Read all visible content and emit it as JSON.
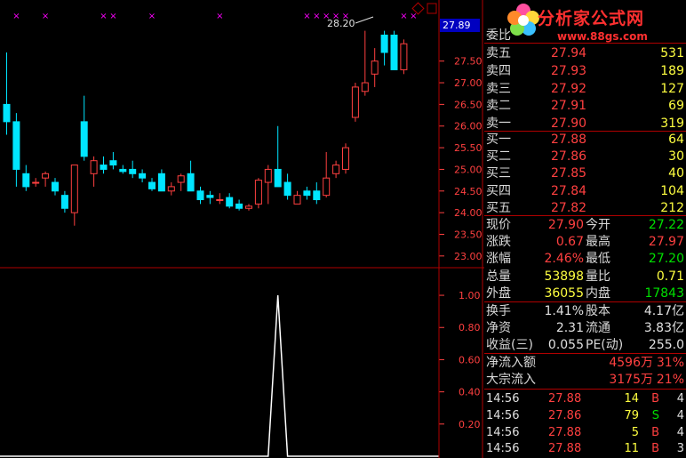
{
  "logo": {
    "title": "分析家公式网",
    "url": "www.88gs.com"
  },
  "price_tag": "27.89",
  "peak_annotation": "28.20",
  "order_book": {
    "header_label": "委比",
    "asks": [
      {
        "label": "卖五",
        "price": "27.94",
        "vol": "531"
      },
      {
        "label": "卖四",
        "price": "27.93",
        "vol": "189"
      },
      {
        "label": "卖三",
        "price": "27.92",
        "vol": "127"
      },
      {
        "label": "卖二",
        "price": "27.91",
        "vol": "69"
      },
      {
        "label": "卖一",
        "price": "27.90",
        "vol": "319"
      }
    ],
    "bids": [
      {
        "label": "买一",
        "price": "27.88",
        "vol": "64"
      },
      {
        "label": "买二",
        "price": "27.86",
        "vol": "30"
      },
      {
        "label": "买三",
        "price": "27.85",
        "vol": "40"
      },
      {
        "label": "买四",
        "price": "27.84",
        "vol": "104"
      },
      {
        "label": "买五",
        "price": "27.82",
        "vol": "212"
      }
    ]
  },
  "quote": [
    {
      "l1": "现价",
      "v1": "27.90",
      "l2": "今开",
      "v2": "27.22"
    },
    {
      "l1": "涨跌",
      "v1": "0.67",
      "l2": "最高",
      "v2": "27.97"
    },
    {
      "l1": "涨幅",
      "v1": "2.46%",
      "l2": "最低",
      "v2": "27.20"
    },
    {
      "l1": "总量",
      "v1": "53898",
      "l2": "量比",
      "v2": "0.71"
    },
    {
      "l1": "外盘",
      "v1": "36055",
      "l2": "内盘",
      "v2": "17843"
    }
  ],
  "fundamentals": [
    {
      "l1": "换手",
      "v1": "1.41%",
      "l2": "股本",
      "v2": "4.17亿"
    },
    {
      "l1": "净资",
      "v1": "2.31",
      "l2": "流通",
      "v2": "3.83亿"
    },
    {
      "l1": "收益(三)",
      "v1": "0.055",
      "l2": "PE(动)",
      "v2": "255.0"
    }
  ],
  "flows": [
    {
      "label": "净流入额",
      "value": "4596万",
      "pct": "31%"
    },
    {
      "label": "大宗流入",
      "value": "3175万",
      "pct": "21%"
    }
  ],
  "ticks": [
    {
      "time": "14:56",
      "price": "27.88",
      "vol": "14",
      "side": "B",
      "n": "4"
    },
    {
      "time": "14:56",
      "price": "27.86",
      "vol": "79",
      "side": "S",
      "n": "4"
    },
    {
      "time": "14:56",
      "price": "27.88",
      "vol": "5",
      "side": "B",
      "n": "4"
    },
    {
      "time": "14:56",
      "price": "27.88",
      "vol": "11",
      "side": "B",
      "n": "3"
    }
  ],
  "colors": {
    "up": "#ff4040",
    "down": "#00e5ff",
    "grid": "#b00000",
    "axis": "#ff4040",
    "indicator": "#ffffff",
    "marker": "#ff00ff"
  },
  "chart_data": [
    {
      "type": "candlestick",
      "y_axis_ticks": [
        "27.50",
        "27.00",
        "26.50",
        "26.00",
        "25.50",
        "25.00",
        "24.50",
        "24.00",
        "23.50",
        "23.00"
      ],
      "ylim": [
        22.75,
        28.5
      ],
      "candles": [
        {
          "o": 26.5,
          "h": 27.7,
          "l": 25.8,
          "c": 26.1
        },
        {
          "o": 26.1,
          "h": 26.3,
          "l": 24.6,
          "c": 25.0
        },
        {
          "o": 24.9,
          "h": 25.1,
          "l": 24.5,
          "c": 24.6
        },
        {
          "o": 24.7,
          "h": 24.8,
          "l": 24.6,
          "c": 24.7
        },
        {
          "o": 24.8,
          "h": 24.95,
          "l": 24.6,
          "c": 24.9
        },
        {
          "o": 24.7,
          "h": 24.8,
          "l": 24.4,
          "c": 24.5
        },
        {
          "o": 24.4,
          "h": 24.5,
          "l": 24.0,
          "c": 24.1
        },
        {
          "o": 24.0,
          "h": 25.1,
          "l": 23.7,
          "c": 25.1
        },
        {
          "o": 26.1,
          "h": 26.7,
          "l": 25.2,
          "c": 25.3
        },
        {
          "o": 24.9,
          "h": 25.3,
          "l": 24.6,
          "c": 25.2
        },
        {
          "o": 25.1,
          "h": 25.3,
          "l": 24.9,
          "c": 25.0
        },
        {
          "o": 25.2,
          "h": 25.4,
          "l": 25.0,
          "c": 25.1
        },
        {
          "o": 25.0,
          "h": 25.1,
          "l": 24.9,
          "c": 24.95
        },
        {
          "o": 25.0,
          "h": 25.2,
          "l": 24.8,
          "c": 24.9
        },
        {
          "o": 24.9,
          "h": 25.0,
          "l": 24.7,
          "c": 24.8
        },
        {
          "o": 24.7,
          "h": 24.8,
          "l": 24.5,
          "c": 24.55
        },
        {
          "o": 24.9,
          "h": 25.0,
          "l": 24.5,
          "c": 24.5
        },
        {
          "o": 24.5,
          "h": 24.7,
          "l": 24.4,
          "c": 24.6
        },
        {
          "o": 24.7,
          "h": 24.9,
          "l": 24.5,
          "c": 24.85
        },
        {
          "o": 24.9,
          "h": 25.2,
          "l": 24.5,
          "c": 24.5
        },
        {
          "o": 24.5,
          "h": 24.6,
          "l": 24.2,
          "c": 24.3
        },
        {
          "o": 24.4,
          "h": 24.5,
          "l": 24.2,
          "c": 24.35
        },
        {
          "o": 24.3,
          "h": 24.45,
          "l": 24.2,
          "c": 24.3
        },
        {
          "o": 24.35,
          "h": 24.45,
          "l": 24.1,
          "c": 24.15
        },
        {
          "o": 24.2,
          "h": 24.3,
          "l": 24.05,
          "c": 24.1
        },
        {
          "o": 24.1,
          "h": 24.2,
          "l": 24.05,
          "c": 24.15
        },
        {
          "o": 24.2,
          "h": 24.8,
          "l": 24.1,
          "c": 24.75
        },
        {
          "o": 24.7,
          "h": 25.1,
          "l": 24.2,
          "c": 25.0
        },
        {
          "o": 25.0,
          "h": 26.0,
          "l": 24.8,
          "c": 24.6
        },
        {
          "o": 24.7,
          "h": 24.9,
          "l": 24.3,
          "c": 24.4
        },
        {
          "o": 24.2,
          "h": 24.5,
          "l": 24.2,
          "c": 24.4
        },
        {
          "o": 24.5,
          "h": 24.6,
          "l": 24.3,
          "c": 24.4
        },
        {
          "o": 24.5,
          "h": 24.7,
          "l": 24.2,
          "c": 24.3
        },
        {
          "o": 24.4,
          "h": 25.4,
          "l": 24.35,
          "c": 24.8
        },
        {
          "o": 24.9,
          "h": 25.2,
          "l": 24.8,
          "c": 25.1
        },
        {
          "o": 25.0,
          "h": 25.6,
          "l": 24.9,
          "c": 25.5
        },
        {
          "o": 26.2,
          "h": 27.0,
          "l": 26.1,
          "c": 26.9
        },
        {
          "o": 26.8,
          "h": 28.2,
          "l": 26.7,
          "c": 27.0
        },
        {
          "o": 27.2,
          "h": 27.8,
          "l": 26.9,
          "c": 27.5
        },
        {
          "o": 28.1,
          "h": 28.2,
          "l": 27.4,
          "c": 27.7
        },
        {
          "o": 28.1,
          "h": 28.2,
          "l": 27.3,
          "c": 27.3
        },
        {
          "o": 27.3,
          "h": 28.0,
          "l": 27.2,
          "c": 27.9
        }
      ],
      "signal_markers": [
        1,
        4,
        10,
        11,
        15,
        22,
        31,
        32,
        33,
        34,
        35,
        41,
        42
      ]
    },
    {
      "type": "line",
      "y_axis_ticks": [
        "1.00",
        "0.80",
        "0.60",
        "0.40",
        "0.20"
      ],
      "ylim": [
        0,
        1.05
      ],
      "values": [
        0,
        0,
        0,
        0,
        0,
        0,
        0,
        0,
        0,
        0,
        0,
        0,
        0,
        0,
        0,
        0,
        0,
        0,
        0,
        0,
        0,
        0,
        0,
        0,
        0,
        0,
        0,
        0,
        1,
        0,
        0,
        0,
        0,
        0,
        0,
        0,
        0,
        0,
        0,
        0,
        0,
        0
      ]
    }
  ]
}
